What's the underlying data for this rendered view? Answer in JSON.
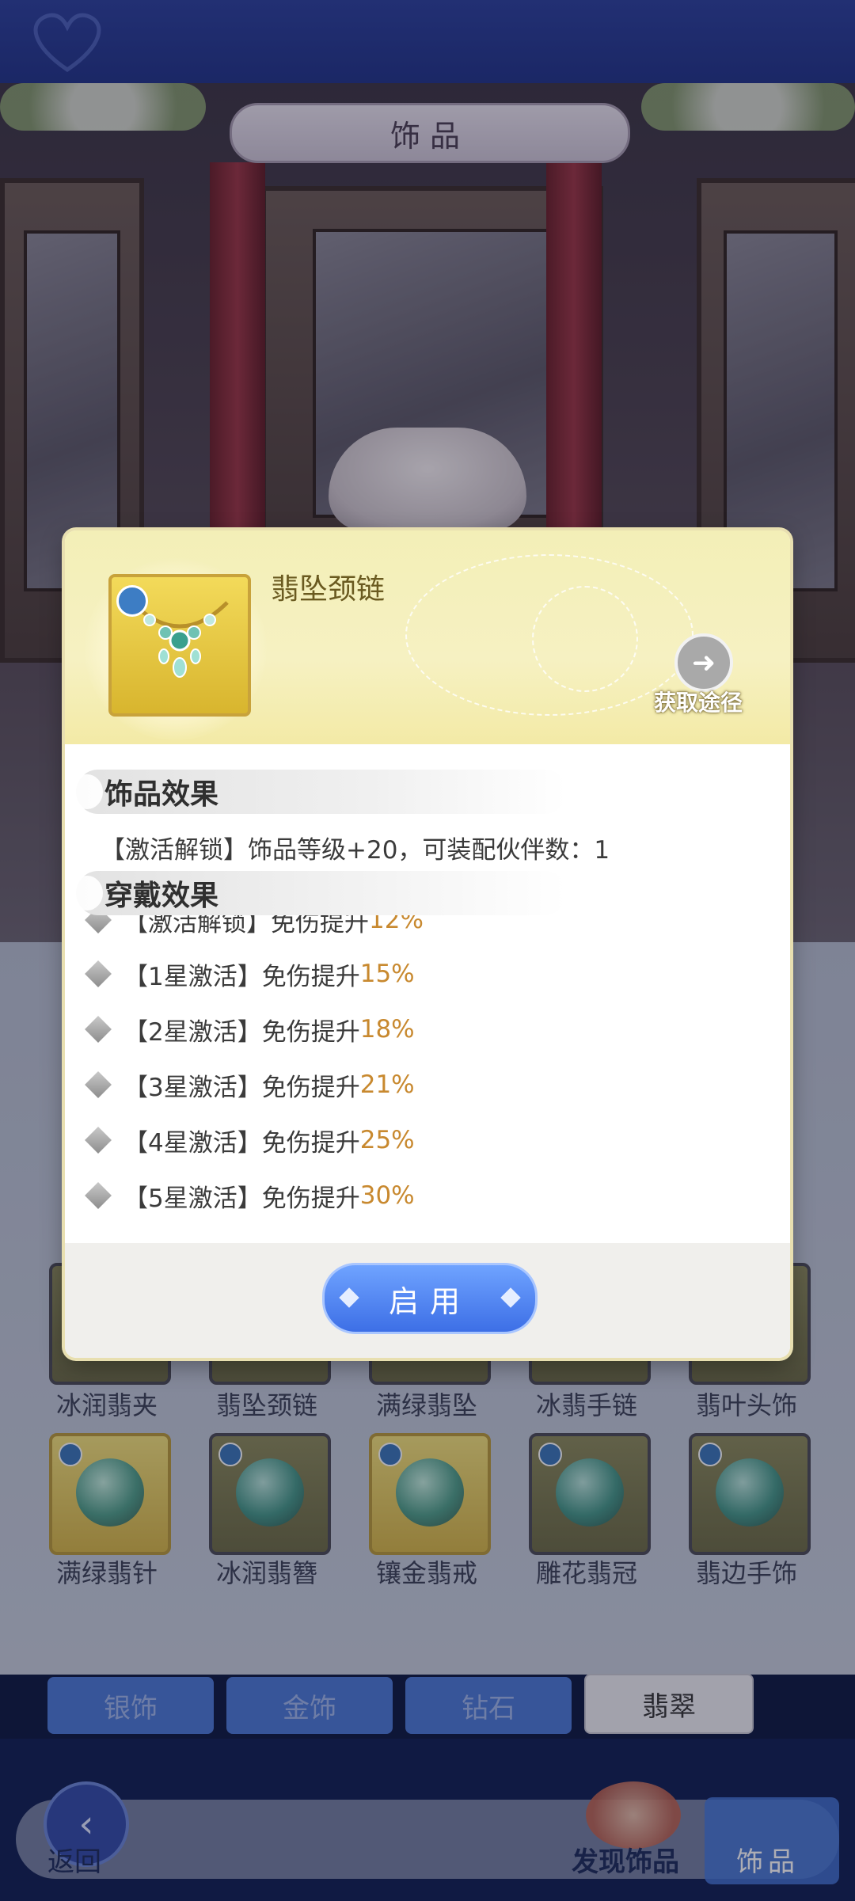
{
  "screen_title": "饰品",
  "modal": {
    "item_name": "翡坠颈链",
    "source_label": "获取途径",
    "section_accessory": "饰品效果",
    "accessory_effect": "【激活解锁】饰品等级+20，可装配伙伴数：1",
    "section_wear": "穿戴效果",
    "wear_effects": [
      {
        "prefix": "【激活解锁】免伤提升",
        "value": "12%"
      },
      {
        "prefix": "【1星激活】免伤提升",
        "value": "15%"
      },
      {
        "prefix": "【2星激活】免伤提升",
        "value": "18%"
      },
      {
        "prefix": "【3星激活】免伤提升",
        "value": "21%"
      },
      {
        "prefix": "【4星激活】免伤提升",
        "value": "25%"
      },
      {
        "prefix": "【5星激活】免伤提升",
        "value": "30%"
      }
    ],
    "use_button": "启用"
  },
  "grid": {
    "row1": [
      "冰润翡夹",
      "翡坠颈链",
      "满绿翡坠",
      "冰翡手链",
      "翡叶头饰"
    ],
    "row2": [
      "满绿翡针",
      "冰润翡簪",
      "镶金翡戒",
      "雕花翡冠",
      "翡边手饰"
    ]
  },
  "tabs": [
    "银饰",
    "金饰",
    "钻石",
    "翡翠"
  ],
  "bottom": {
    "back": "返回",
    "discover": "发现饰品",
    "jewelry": "饰品"
  },
  "colors": {
    "accent_blue": "#4b78d6",
    "value_orange": "#c8892f",
    "header_yellow": "#f3efb7"
  }
}
